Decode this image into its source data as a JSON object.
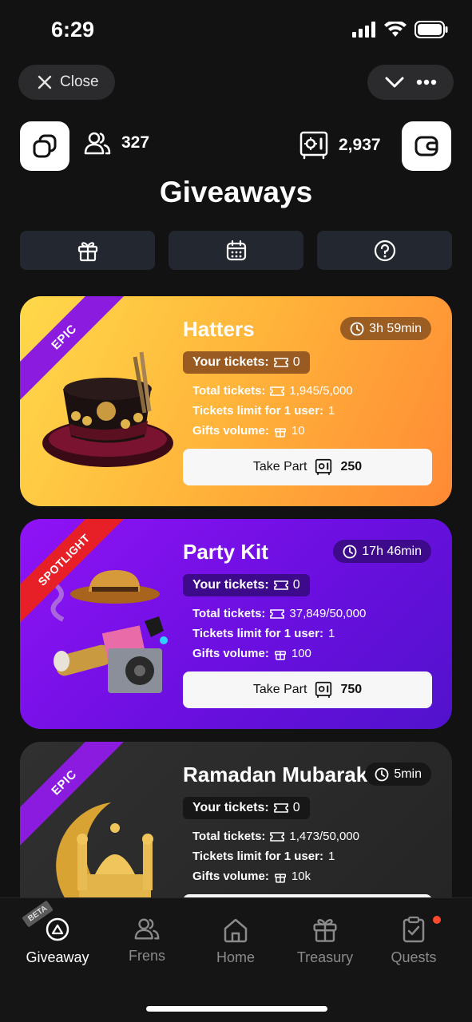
{
  "status_bar": {
    "time": "6:29"
  },
  "top_nav": {
    "close_label": "Close"
  },
  "header": {
    "frens_count": "327",
    "tickets_count": "2,937"
  },
  "page_title": "Giveaways",
  "tabs": [
    {
      "icon": "gift-icon"
    },
    {
      "icon": "calendar-icon"
    },
    {
      "icon": "help-icon"
    }
  ],
  "cards": [
    {
      "ribbon": "EPIC",
      "title": "Hatters",
      "timer": "3h 59min",
      "your_tickets_label": "Your tickets:",
      "your_tickets_value": "0",
      "total_tickets_label": "Total tickets:",
      "total_tickets_value": "1,945/5,000",
      "limit_label": "Tickets limit for 1 user:",
      "limit_value": "1",
      "gifts_label": "Gifts volume:",
      "gifts_value": "10",
      "button_label": "Take Part",
      "button_price": "250"
    },
    {
      "ribbon": "SPOTLIGHT",
      "title": "Party Kit",
      "timer": "17h 46min",
      "your_tickets_label": "Your tickets:",
      "your_tickets_value": "0",
      "total_tickets_label": "Total tickets:",
      "total_tickets_value": "37,849/50,000",
      "limit_label": "Tickets limit for 1 user:",
      "limit_value": "1",
      "gifts_label": "Gifts volume:",
      "gifts_value": "100",
      "button_label": "Take Part",
      "button_price": "750"
    },
    {
      "ribbon": "EPIC",
      "title": "Ramadan Mubarak",
      "timer": "5min",
      "your_tickets_label": "Your tickets:",
      "your_tickets_value": "0",
      "total_tickets_label": "Total tickets:",
      "total_tickets_value": "1,473/50,000",
      "limit_label": "Tickets limit for 1 user:",
      "limit_value": "1",
      "gifts_label": "Gifts volume:",
      "gifts_value": "10k"
    }
  ],
  "bottom_nav": [
    {
      "label": "Giveaway",
      "badge": "BETA",
      "active": true
    },
    {
      "label": "Frens"
    },
    {
      "label": "Home"
    },
    {
      "label": "Treasury"
    },
    {
      "label": "Quests"
    }
  ],
  "colors": {
    "background": "#121212",
    "card1_gradient_start": "#ffd94a",
    "card1_gradient_end": "#ff8a35",
    "card2_gradient_start": "#8f13f6",
    "card2_gradient_end": "#5112cc",
    "ribbon_epic": "#8a1bdf",
    "ribbon_spotlight": "#e72028"
  }
}
